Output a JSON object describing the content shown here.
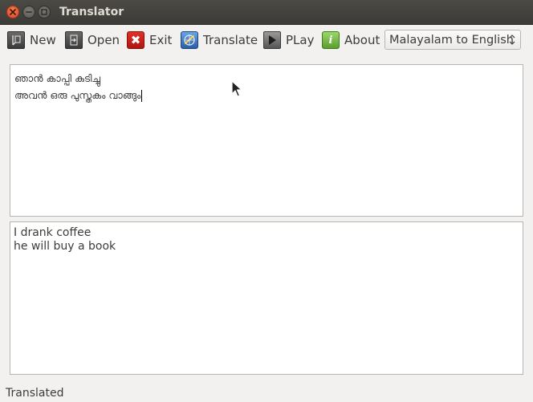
{
  "window": {
    "title": "Translator"
  },
  "toolbar": {
    "items": [
      {
        "label": "New",
        "icon": "new-document-icon"
      },
      {
        "label": "Open",
        "icon": "open-icon"
      },
      {
        "label": "Exit",
        "icon": "exit-icon"
      },
      {
        "label": "Translate",
        "icon": "translate-icon"
      },
      {
        "label": "PLay",
        "icon": "play-icon"
      },
      {
        "label": "About",
        "icon": "about-info-icon"
      }
    ],
    "language_select": {
      "selected": "Malayalam to English"
    }
  },
  "input": {
    "lines": [
      "ഞാൻ കാപ്പി കുടിച്ചു",
      "അവൻ ഒരു പുസ്തകം വാങ്ങും"
    ]
  },
  "output": {
    "lines": [
      "I drank coffee",
      "he will buy a book"
    ]
  },
  "status": {
    "text": "Translated"
  },
  "colors": {
    "titlebar": "#3c3b37",
    "close_button": "#e0471b",
    "exit_icon": "#c41c16",
    "about_icon": "#6fb33a",
    "translate_icon": "#3d7bc7",
    "background": "#f2f1f0"
  }
}
